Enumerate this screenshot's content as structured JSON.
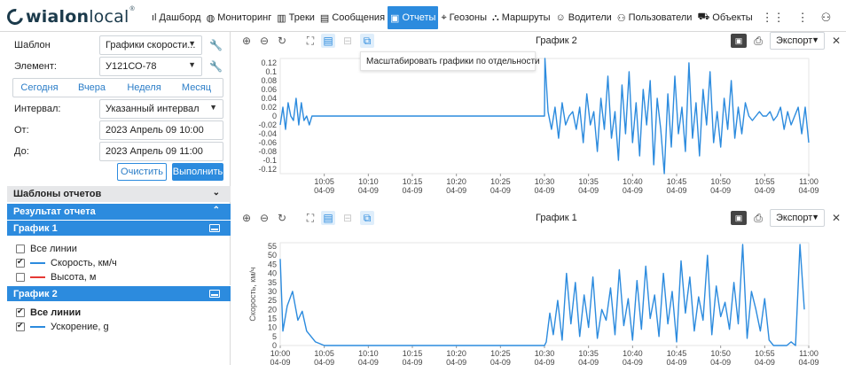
{
  "logo": {
    "text_bold": "wialon",
    "text_light": "local",
    "mark": "®"
  },
  "nav": {
    "items": [
      {
        "label": "Дашборд",
        "icon": "chart-bars-icon"
      },
      {
        "label": "Мониторинг",
        "icon": "globe-icon"
      },
      {
        "label": "Треки",
        "icon": "track-icon"
      },
      {
        "label": "Сообщения",
        "icon": "messages-icon"
      },
      {
        "label": "Отчеты",
        "icon": "reports-icon",
        "active": true
      },
      {
        "label": "Геозоны",
        "icon": "geofence-icon"
      },
      {
        "label": "Маршруты",
        "icon": "route-icon"
      },
      {
        "label": "Водители",
        "icon": "driver-icon"
      },
      {
        "label": "Пользователи",
        "icon": "user-icon"
      },
      {
        "label": "Объекты",
        "icon": "car-icon"
      }
    ]
  },
  "left": {
    "template_label": "Шаблон",
    "template_value": "Графики скорости...",
    "element_label": "Элемент:",
    "element_value": "У121СО-78",
    "periods": [
      "Сегодня",
      "Вчера",
      "Неделя",
      "Месяц"
    ],
    "interval_label": "Интервал:",
    "interval_value": "Указанный интервал",
    "from_label": "От:",
    "from_value": "2023 Апрель 09 10:00",
    "to_label": "До:",
    "to_value": "2023 Апрель 09 11:00",
    "clear_label": "Очистить",
    "run_label": "Выполнить",
    "templates_header": "Шаблоны отчетов",
    "result_header": "Результат отчета",
    "graph1_header": "График 1",
    "graph1_all": "Все линии",
    "graph1_lines": [
      {
        "label": "Скорость, км/ч",
        "checked": true,
        "color": "#2c8bde"
      },
      {
        "label": "Высота, м",
        "checked": false,
        "color": "#e53935"
      }
    ],
    "graph2_header": "График 2",
    "graph2_all": "Все линии",
    "graph2_lines": [
      {
        "label": "Ускорение, g",
        "checked": true,
        "color": "#2c8bde"
      }
    ]
  },
  "panel_top": {
    "title": "График 2",
    "export_label": "Экспорт",
    "tooltip": "Масштабировать графики по отдельности"
  },
  "panel_bottom": {
    "title": "График 1",
    "export_label": "Экспорт"
  },
  "chart_data": [
    {
      "type": "line",
      "title": "График 2",
      "series": [
        {
          "name": "Ускорение, g",
          "color": "#2c8bde"
        }
      ],
      "yticks": [
        "0.12",
        "0.1",
        "0.08",
        "0.06",
        "0.04",
        "0.02",
        "0",
        "-0.02",
        "-0.04",
        "-0.06",
        "-0.08",
        "-0.1",
        "-0.12"
      ],
      "ylim": [
        -0.13,
        0.13
      ],
      "xticks": [
        [
          "10:05",
          "04-09"
        ],
        [
          "10:10",
          "04-09"
        ],
        [
          "10:15",
          "04-09"
        ],
        [
          "10:20",
          "04-09"
        ],
        [
          "10:25",
          "04-09"
        ],
        [
          "10:30",
          "04-09"
        ],
        [
          "10:35",
          "04-09"
        ],
        [
          "10:40",
          "04-09"
        ],
        [
          "10:45",
          "04-09"
        ],
        [
          "10:50",
          "04-09"
        ],
        [
          "10:55",
          "04-09"
        ],
        [
          "11:00",
          "04-09"
        ]
      ],
      "x": [
        0,
        0.3,
        0.6,
        0.9,
        1.2,
        1.5,
        1.8,
        2.1,
        2.4,
        2.7,
        3,
        3.3,
        3.6,
        4,
        10,
        20,
        30,
        30.05,
        30.4,
        30.8,
        31.2,
        31.6,
        32,
        32.4,
        32.8,
        33.2,
        33.6,
        34,
        34.4,
        34.8,
        35.2,
        35.6,
        36,
        36.4,
        36.8,
        37.2,
        37.6,
        38,
        38.4,
        38.8,
        39.2,
        39.6,
        40,
        40.4,
        40.8,
        41.2,
        41.6,
        42,
        42.4,
        42.8,
        43.2,
        43.6,
        44,
        44.4,
        44.8,
        45.2,
        45.6,
        46,
        46.4,
        46.8,
        47.2,
        47.6,
        48,
        48.4,
        48.8,
        49.2,
        49.6,
        50,
        50.4,
        50.8,
        51.2,
        51.6,
        52,
        52.4,
        52.8,
        53.2,
        53.6,
        54,
        54.4,
        54.8,
        55.2,
        55.6,
        56,
        56.4,
        56.8,
        57.2,
        57.6,
        58,
        58.4,
        58.8,
        59.2,
        59.6,
        60
      ],
      "y": [
        -0.02,
        0.02,
        -0.03,
        0.03,
        0.0,
        -0.01,
        0.04,
        -0.02,
        0.03,
        -0.01,
        0.0,
        -0.02,
        0.0,
        0.0,
        0.0,
        0.0,
        0.0,
        0.13,
        0.01,
        -0.03,
        0.02,
        -0.05,
        0.03,
        -0.02,
        0.0,
        0.01,
        -0.03,
        0.02,
        -0.06,
        0.05,
        -0.02,
        0.01,
        -0.08,
        0.04,
        -0.03,
        0.09,
        -0.05,
        0.01,
        -0.1,
        0.07,
        -0.04,
        0.1,
        -0.06,
        0.03,
        -0.09,
        0.06,
        -0.02,
        0.08,
        -0.11,
        0.04,
        -0.03,
        -0.13,
        0.05,
        -0.07,
        0.09,
        -0.04,
        0.02,
        -0.08,
        0.12,
        -0.05,
        0.03,
        -0.09,
        0.06,
        -0.02,
        0.1,
        -0.06,
        0.01,
        -0.07,
        0.04,
        -0.03,
        0.08,
        -0.05,
        0.02,
        -0.04,
        0.03,
        0.0,
        -0.01,
        0.0,
        0.01,
        0.0,
        0.0,
        0.01,
        -0.01,
        0.0,
        0.02,
        -0.03,
        0.01,
        -0.02,
        0.0,
        0.02,
        -0.04,
        0.02,
        -0.06
      ]
    },
    {
      "type": "line",
      "title": "График 1",
      "ylabel": "Скорость, км/ч",
      "series": [
        {
          "name": "Скорость, км/ч",
          "color": "#2c8bde"
        }
      ],
      "yticks": [
        "55",
        "50",
        "45",
        "40",
        "35",
        "30",
        "25",
        "20",
        "15",
        "10",
        "5",
        "0"
      ],
      "ylim": [
        0,
        57
      ],
      "xticks": [
        [
          "10:00",
          "04-09"
        ],
        [
          "10:05",
          "04-09"
        ],
        [
          "10:10",
          "04-09"
        ],
        [
          "10:15",
          "04-09"
        ],
        [
          "10:20",
          "04-09"
        ],
        [
          "10:25",
          "04-09"
        ],
        [
          "10:30",
          "04-09"
        ],
        [
          "10:35",
          "04-09"
        ],
        [
          "10:40",
          "04-09"
        ],
        [
          "10:45",
          "04-09"
        ],
        [
          "10:50",
          "04-09"
        ],
        [
          "10:55",
          "04-09"
        ],
        [
          "11:00",
          "04-09"
        ]
      ],
      "x": [
        0,
        0.3,
        0.8,
        1.4,
        2,
        2.5,
        3,
        4,
        5,
        6,
        10,
        20,
        30,
        30.2,
        30.6,
        31,
        31.5,
        32,
        32.5,
        33,
        33.5,
        34,
        34.5,
        35,
        35.5,
        36,
        36.5,
        37,
        37.5,
        38,
        38.5,
        39,
        39.5,
        40,
        40.5,
        41,
        41.5,
        42,
        42.5,
        43,
        43.5,
        44,
        44.5,
        45,
        45.5,
        46,
        46.5,
        47,
        47.5,
        48,
        48.5,
        49,
        49.5,
        50,
        50.5,
        51,
        51.5,
        52,
        52.5,
        53,
        53.5,
        54,
        54.5,
        55,
        55.5,
        56,
        56.5,
        57,
        57.5,
        58,
        58.5,
        59,
        59.5,
        60
      ],
      "y": [
        48,
        8,
        22,
        30,
        14,
        19,
        8,
        2,
        0,
        0,
        0,
        0,
        0,
        2,
        18,
        6,
        25,
        3,
        40,
        12,
        35,
        5,
        28,
        10,
        38,
        4,
        20,
        14,
        32,
        6,
        42,
        11,
        26,
        3,
        36,
        9,
        44,
        15,
        28,
        5,
        40,
        12,
        30,
        2,
        47,
        18,
        38,
        8,
        27,
        14,
        50,
        6,
        33,
        16,
        24,
        9,
        35,
        12,
        56,
        4,
        30,
        20,
        8,
        26,
        3,
        0,
        0,
        0,
        0,
        2,
        0,
        56,
        20
      ]
    }
  ]
}
